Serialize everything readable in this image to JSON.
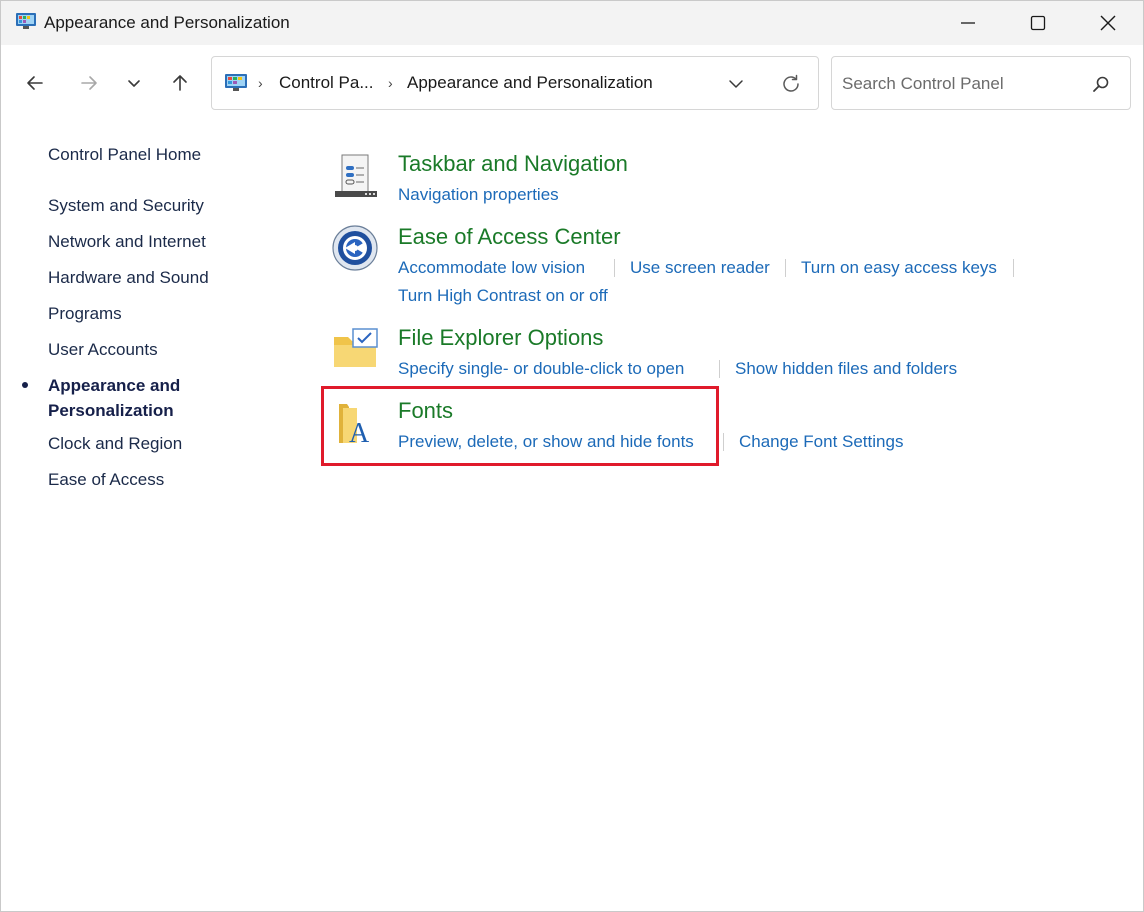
{
  "window": {
    "title": "Appearance and Personalization"
  },
  "address_bar": {
    "crumbs": [
      "Control Pa...",
      "Appearance and Personalization"
    ]
  },
  "search": {
    "placeholder": "Search Control Panel",
    "value": ""
  },
  "sidebar": {
    "home": "Control Panel Home",
    "items": [
      "System and Security",
      "Network and Internet",
      "Hardware and Sound",
      "Programs",
      "User Accounts"
    ],
    "current": "Appearance and Personalization",
    "items_after": [
      "Clock and Region",
      "Ease of Access"
    ]
  },
  "sections": [
    {
      "title": "Taskbar and Navigation",
      "icon": "taskbar-icon",
      "tasks": [
        "Navigation properties"
      ]
    },
    {
      "title": "Ease of Access Center",
      "icon": "ease-of-access-icon",
      "tasks": [
        "Accommodate low vision",
        "Use screen reader",
        "Turn on easy access keys",
        "Turn High Contrast on or off"
      ]
    },
    {
      "title": "File Explorer Options",
      "icon": "folder-options-icon",
      "tasks": [
        "Specify single- or double-click to open",
        "Show hidden files and folders"
      ]
    },
    {
      "title": "Fonts",
      "icon": "fonts-folder-icon",
      "tasks": [
        "Preview, delete, or show and hide fonts",
        "Change Font Settings"
      ]
    }
  ],
  "colors": {
    "section_title": "#1a7a28",
    "task_link": "#1c6ab8",
    "highlight_border": "#e01a2b"
  }
}
